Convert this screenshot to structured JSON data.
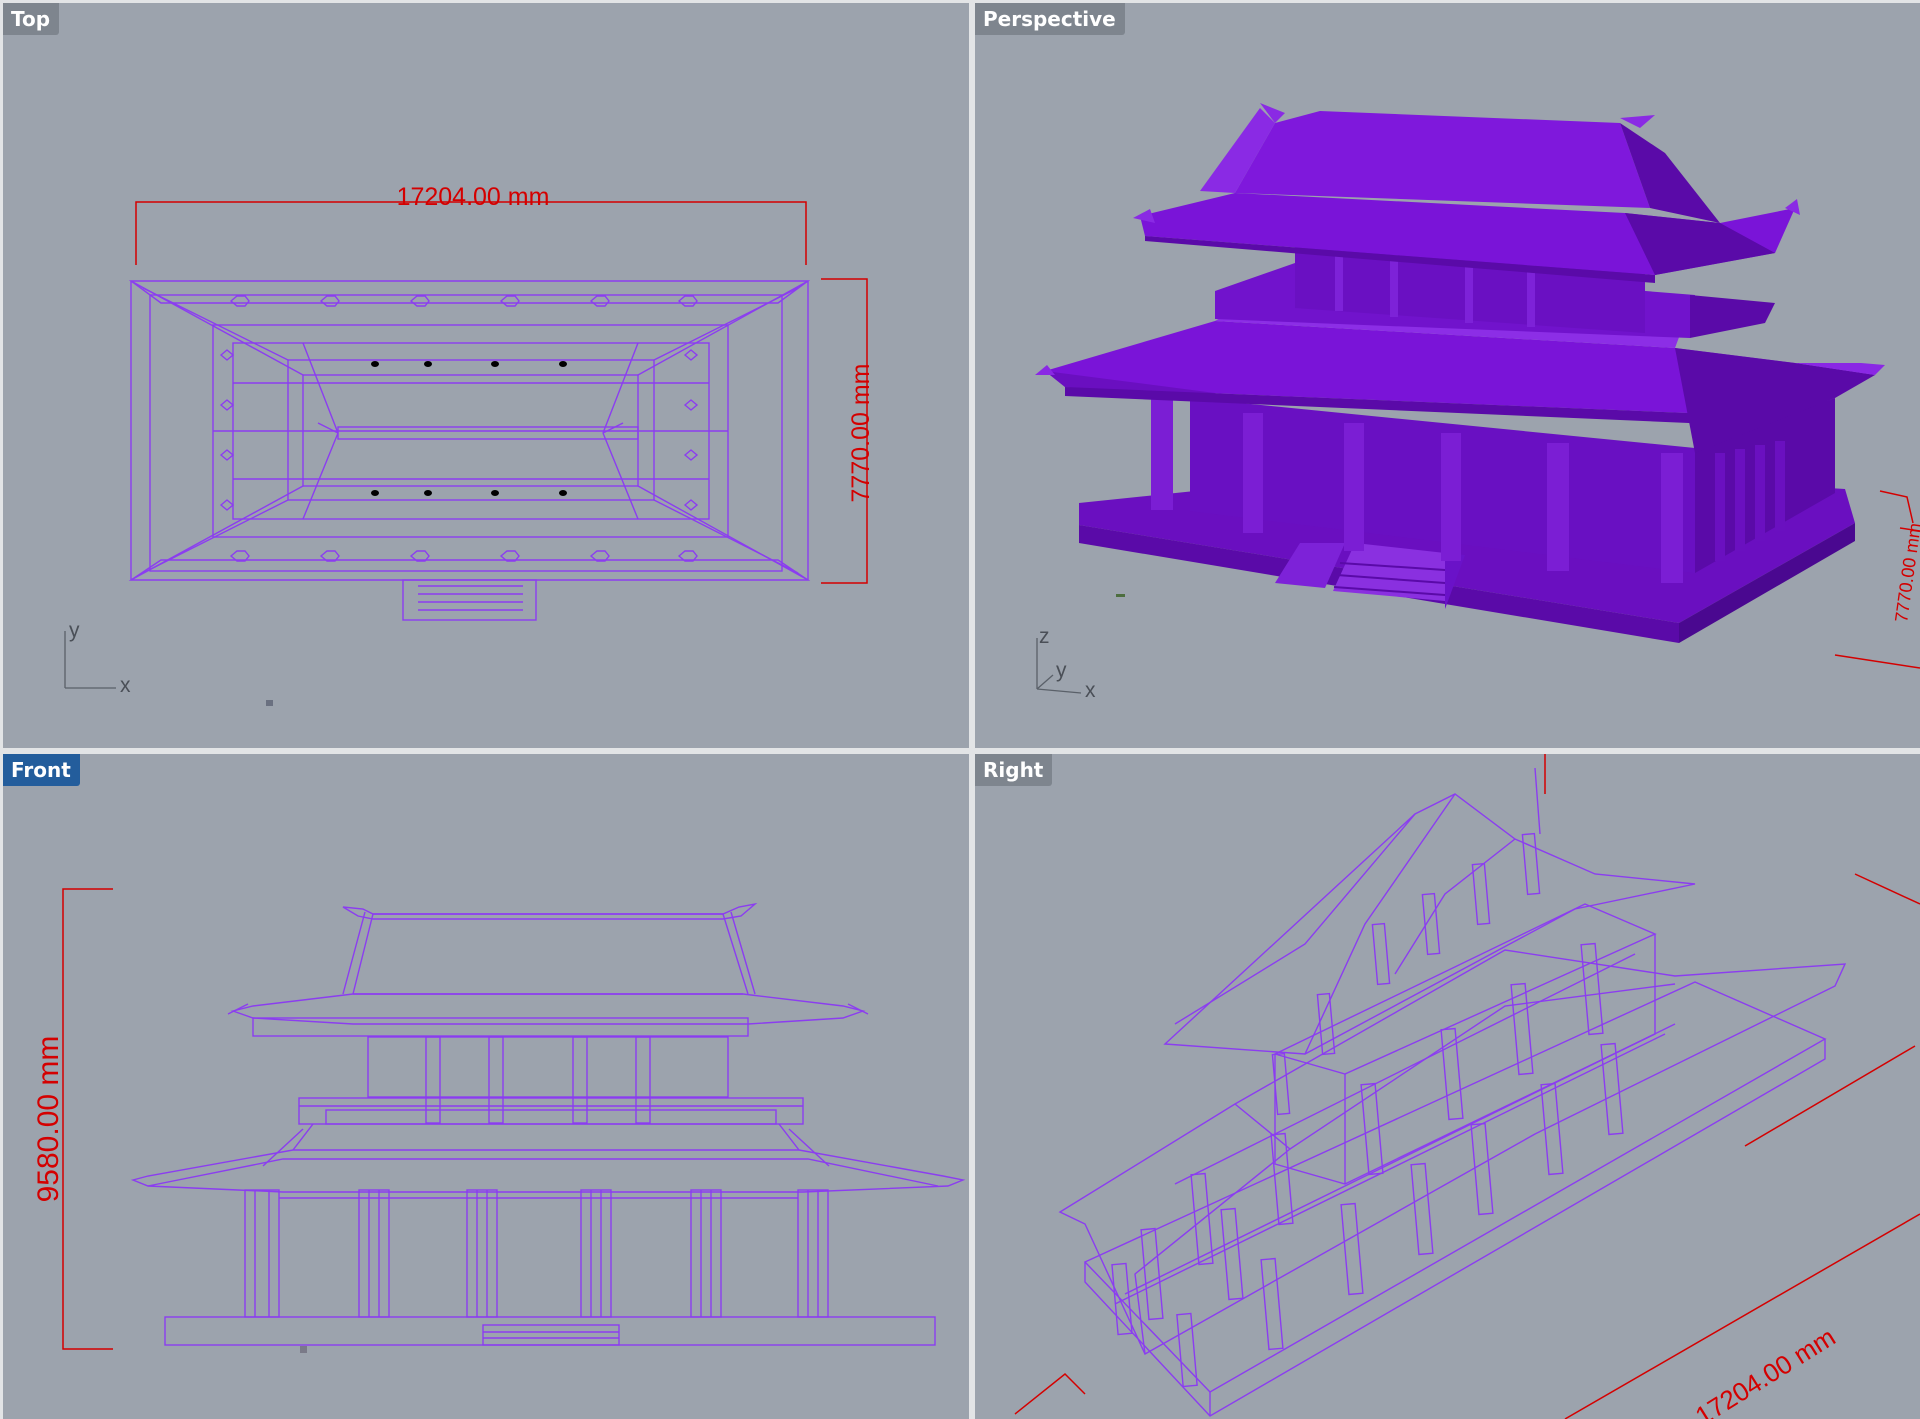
{
  "viewports": {
    "top": {
      "label": "Top",
      "dimension_width": "17204.00 mm",
      "dimension_depth": "7770.00 mm",
      "axes": [
        "y",
        "x"
      ]
    },
    "perspective": {
      "label": "Perspective",
      "dimension_partial": "7770.00 mm",
      "axes": [
        "z",
        "y",
        "x"
      ]
    },
    "front": {
      "label": "Front",
      "dimension_height": "9580.00 mm",
      "active": true
    },
    "right": {
      "label": "Right",
      "dimension_length": "17204.00 mm"
    }
  },
  "colors": {
    "viewport_bg": "#9ca3ad",
    "wireframe": "#8b3df0",
    "shaded_model": "#7a12d4",
    "dimension": "#d40000",
    "active_label": "#235d9c",
    "label_bg": "#7e858e"
  }
}
